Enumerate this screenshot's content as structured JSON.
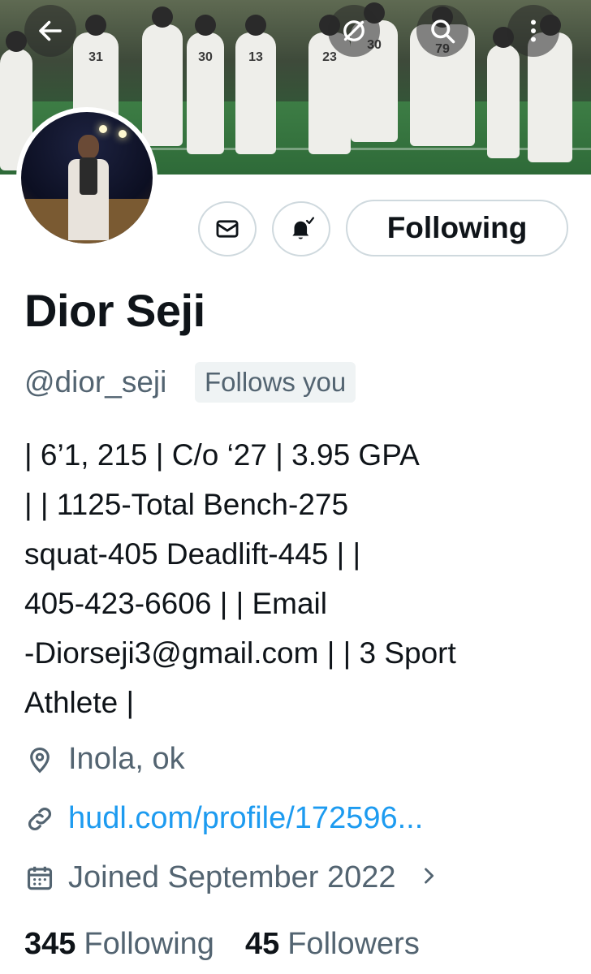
{
  "header": {
    "back_icon": "arrow-left-icon",
    "grok_icon": "slash-circle-icon",
    "search_icon": "search-icon",
    "more_icon": "more-vertical-icon",
    "banner_jersey_numbers": [
      "31",
      "30",
      "13",
      "23",
      "30",
      "79"
    ]
  },
  "actions": {
    "message_icon": "envelope-icon",
    "notify_icon": "bell-check-icon",
    "following_label": "Following"
  },
  "profile": {
    "name": "Dior Seji",
    "handle": "@dior_seji",
    "follows_you": "Follows you",
    "bio_lines": [
      "| 6’1, 215 | C/o ‘27 | 3.95 GPA",
      "| | 1125-Total Bench-275",
      "squat-405 Deadlift-445 | |",
      "405-423-6606 | | Email",
      "-Diorseji3@gmail.com | | 3 Sport",
      "Athlete |"
    ],
    "location": "Inola, ok",
    "website": "hudl.com/profile/172596...",
    "joined": "Joined September 2022"
  },
  "stats": {
    "following_count": "345",
    "following_label": "Following",
    "followers_count": "45",
    "followers_label": "Followers"
  },
  "colors": {
    "text": "#0f1419",
    "secondary": "#536471",
    "link": "#1d9bf0",
    "border": "#cfd9de"
  }
}
